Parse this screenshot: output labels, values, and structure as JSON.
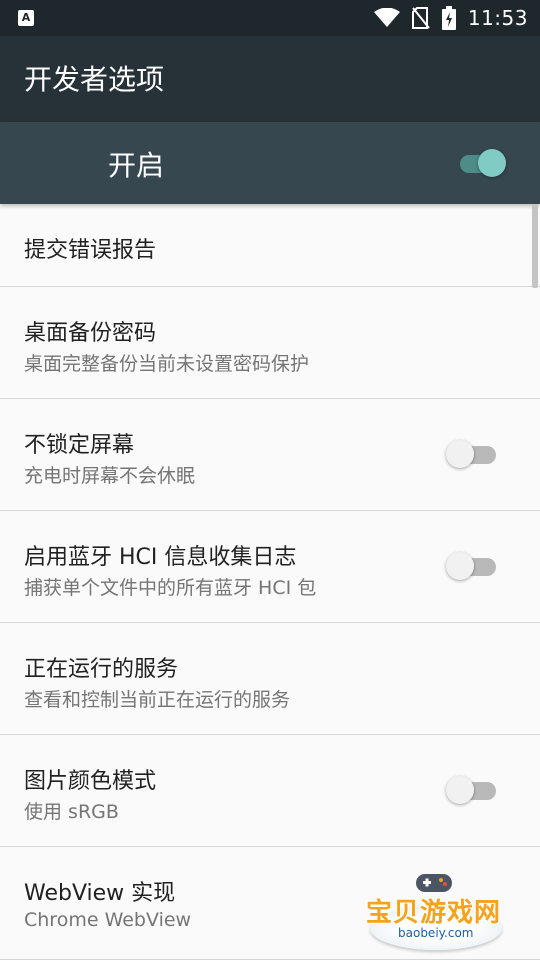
{
  "status_bar": {
    "notification_icon": "a-notification-icon",
    "wifi_icon": "wifi-icon",
    "no_sim_icon": "no-sim-icon",
    "battery_icon": "battery-charging-icon",
    "time": "11:53"
  },
  "toolbar": {
    "title": "开发者选项"
  },
  "master_switch": {
    "label": "开启",
    "checked": true
  },
  "items": [
    {
      "title": "提交错误报告"
    },
    {
      "title": "桌面备份密码",
      "summary": "桌面完整备份当前未设置密码保护"
    },
    {
      "title": "不锁定屏幕",
      "summary": "充电时屏幕不会休眠",
      "checked": false
    },
    {
      "title": "启用蓝牙 HCI 信息收集日志",
      "summary": "捕获单个文件中的所有蓝牙 HCI 包",
      "checked": false
    },
    {
      "title": "正在运行的服务",
      "summary": "查看和控制当前正在运行的服务"
    },
    {
      "title": "图片颜色模式",
      "summary": "使用 sRGB",
      "checked": false
    },
    {
      "title": "WebView 实现",
      "summary": "Chrome WebView"
    }
  ],
  "watermark": {
    "text": "宝贝游戏网",
    "url": "baobeiy.com"
  },
  "colors": {
    "status_bar": "#1e272c",
    "toolbar": "#263238",
    "master_bar": "#37474f",
    "switch_on": "#80cbc4"
  }
}
